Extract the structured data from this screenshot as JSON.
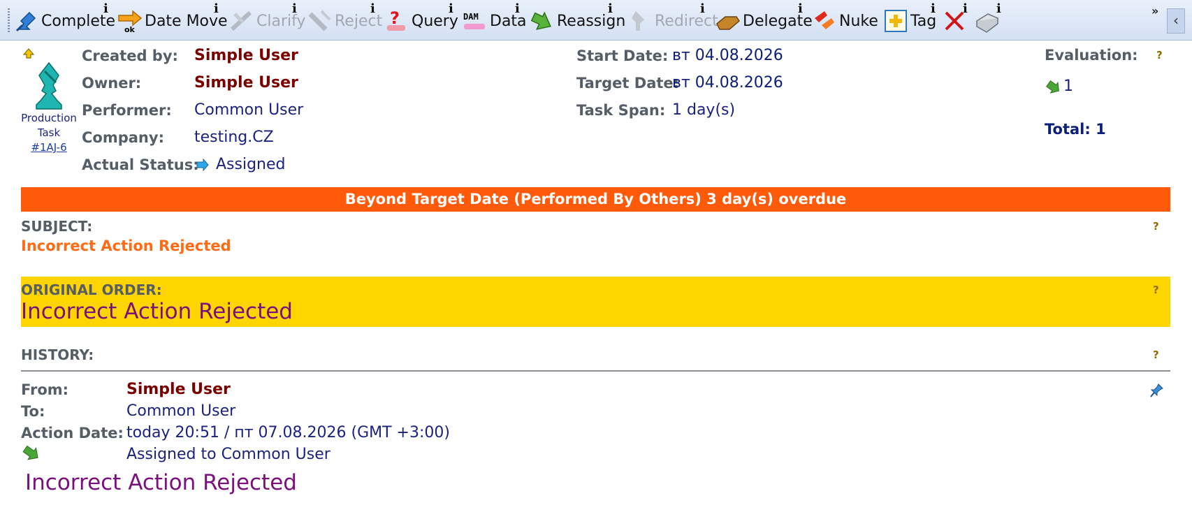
{
  "toolbar": {
    "info_glyph": "i",
    "more_glyph": "»",
    "collapse_glyph": "‹",
    "buttons": [
      {
        "label": "Complete",
        "icon": "complete-icon",
        "enabled": true
      },
      {
        "label": "Date Move",
        "icon": "date-move-icon",
        "enabled": true
      },
      {
        "label": "Clarify",
        "icon": "clarify-icon",
        "enabled": false
      },
      {
        "label": "Reject",
        "icon": "reject-icon",
        "enabled": false
      },
      {
        "label": "Query",
        "icon": "query-icon",
        "enabled": true
      },
      {
        "label": "Data",
        "icon": "data-icon",
        "enabled": true
      },
      {
        "label": "Reassign",
        "icon": "reassign-icon",
        "enabled": true
      },
      {
        "label": "Redirect",
        "icon": "redirect-icon",
        "enabled": false
      },
      {
        "label": "Delegate",
        "icon": "delegate-icon",
        "enabled": true
      },
      {
        "label": "Nuke",
        "icon": "nuke-icon",
        "enabled": true
      },
      {
        "label": "Tag",
        "icon": "tag-icon",
        "enabled": true
      },
      {
        "label": "",
        "icon": "delete-x-icon",
        "enabled": true
      },
      {
        "label": "",
        "icon": "print-icon",
        "enabled": true
      }
    ],
    "data_icon_text": "DAM"
  },
  "task": {
    "type_label_line1": "Production",
    "type_label_line2": "Task",
    "id": "#1AJ-6"
  },
  "details": {
    "created_by_label": "Created by:",
    "created_by": "Simple User",
    "owner_label": "Owner:",
    "owner": "Simple User",
    "performer_label": "Performer:",
    "performer": "Common User",
    "company_label": "Company:",
    "company": "testing.CZ",
    "status_label": "Actual Status:",
    "status": "Assigned",
    "start_date_label": "Start Date:",
    "start_date": "вт 04.08.2026",
    "target_date_label": "Target Date:",
    "target_date": "вт 04.08.2026",
    "task_span_label": "Task Span:",
    "task_span": "1 day(s)",
    "evaluation_label": "Evaluation:",
    "evaluation_value": "1",
    "total": "Total: 1"
  },
  "overdue_banner": "Beyond Target Date (Performed By Others) 3 day(s) overdue",
  "subject": {
    "label": "SUBJECT:",
    "value": "Incorrect Action Rejected"
  },
  "original_order": {
    "label": "ORIGINAL ORDER:",
    "value": "Incorrect Action Rejected"
  },
  "history": {
    "label": "HISTORY:",
    "from_label": "From:",
    "from": "Simple User",
    "to_label": "To:",
    "to": "Common User",
    "action_date_label": "Action Date:",
    "action_date": "today 20:51 / пт 07.08.2026 (GMT +3:00)",
    "action_text": "Assigned to Common User",
    "message": "Incorrect Action Rejected"
  },
  "help_glyph": "?",
  "colors": {
    "overdue_bg": "#ff5a0a",
    "order_bg": "#ffd500",
    "subject_text": "#ff6a14",
    "message_text": "#7b0f7e",
    "user_red": "#7a0000",
    "value_navy": "#1a237e"
  }
}
